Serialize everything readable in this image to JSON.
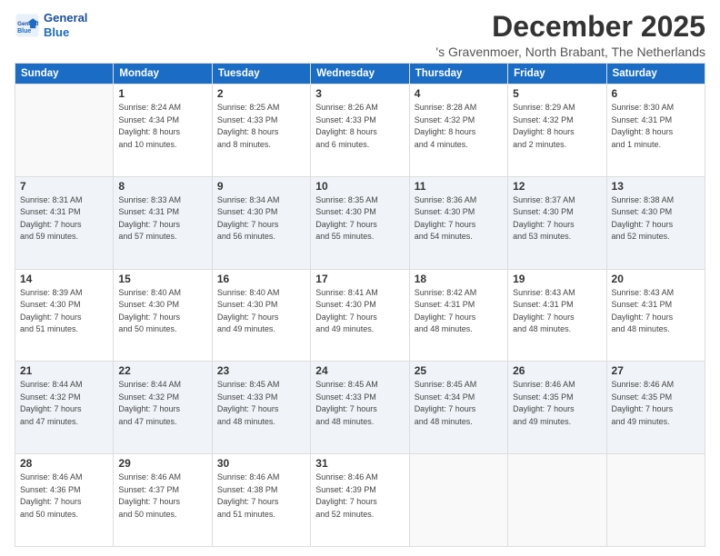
{
  "logo": {
    "line1": "General",
    "line2": "Blue"
  },
  "title": "December 2025",
  "location": "'s Gravenmoer, North Brabant, The Netherlands",
  "days_header": [
    "Sunday",
    "Monday",
    "Tuesday",
    "Wednesday",
    "Thursday",
    "Friday",
    "Saturday"
  ],
  "weeks": [
    [
      {
        "day": "",
        "info": ""
      },
      {
        "day": "1",
        "info": "Sunrise: 8:24 AM\nSunset: 4:34 PM\nDaylight: 8 hours\nand 10 minutes."
      },
      {
        "day": "2",
        "info": "Sunrise: 8:25 AM\nSunset: 4:33 PM\nDaylight: 8 hours\nand 8 minutes."
      },
      {
        "day": "3",
        "info": "Sunrise: 8:26 AM\nSunset: 4:33 PM\nDaylight: 8 hours\nand 6 minutes."
      },
      {
        "day": "4",
        "info": "Sunrise: 8:28 AM\nSunset: 4:32 PM\nDaylight: 8 hours\nand 4 minutes."
      },
      {
        "day": "5",
        "info": "Sunrise: 8:29 AM\nSunset: 4:32 PM\nDaylight: 8 hours\nand 2 minutes."
      },
      {
        "day": "6",
        "info": "Sunrise: 8:30 AM\nSunset: 4:31 PM\nDaylight: 8 hours\nand 1 minute."
      }
    ],
    [
      {
        "day": "7",
        "info": "Sunrise: 8:31 AM\nSunset: 4:31 PM\nDaylight: 7 hours\nand 59 minutes."
      },
      {
        "day": "8",
        "info": "Sunrise: 8:33 AM\nSunset: 4:31 PM\nDaylight: 7 hours\nand 57 minutes."
      },
      {
        "day": "9",
        "info": "Sunrise: 8:34 AM\nSunset: 4:30 PM\nDaylight: 7 hours\nand 56 minutes."
      },
      {
        "day": "10",
        "info": "Sunrise: 8:35 AM\nSunset: 4:30 PM\nDaylight: 7 hours\nand 55 minutes."
      },
      {
        "day": "11",
        "info": "Sunrise: 8:36 AM\nSunset: 4:30 PM\nDaylight: 7 hours\nand 54 minutes."
      },
      {
        "day": "12",
        "info": "Sunrise: 8:37 AM\nSunset: 4:30 PM\nDaylight: 7 hours\nand 53 minutes."
      },
      {
        "day": "13",
        "info": "Sunrise: 8:38 AM\nSunset: 4:30 PM\nDaylight: 7 hours\nand 52 minutes."
      }
    ],
    [
      {
        "day": "14",
        "info": "Sunrise: 8:39 AM\nSunset: 4:30 PM\nDaylight: 7 hours\nand 51 minutes."
      },
      {
        "day": "15",
        "info": "Sunrise: 8:40 AM\nSunset: 4:30 PM\nDaylight: 7 hours\nand 50 minutes."
      },
      {
        "day": "16",
        "info": "Sunrise: 8:40 AM\nSunset: 4:30 PM\nDaylight: 7 hours\nand 49 minutes."
      },
      {
        "day": "17",
        "info": "Sunrise: 8:41 AM\nSunset: 4:30 PM\nDaylight: 7 hours\nand 49 minutes."
      },
      {
        "day": "18",
        "info": "Sunrise: 8:42 AM\nSunset: 4:31 PM\nDaylight: 7 hours\nand 48 minutes."
      },
      {
        "day": "19",
        "info": "Sunrise: 8:43 AM\nSunset: 4:31 PM\nDaylight: 7 hours\nand 48 minutes."
      },
      {
        "day": "20",
        "info": "Sunrise: 8:43 AM\nSunset: 4:31 PM\nDaylight: 7 hours\nand 48 minutes."
      }
    ],
    [
      {
        "day": "21",
        "info": "Sunrise: 8:44 AM\nSunset: 4:32 PM\nDaylight: 7 hours\nand 47 minutes."
      },
      {
        "day": "22",
        "info": "Sunrise: 8:44 AM\nSunset: 4:32 PM\nDaylight: 7 hours\nand 47 minutes."
      },
      {
        "day": "23",
        "info": "Sunrise: 8:45 AM\nSunset: 4:33 PM\nDaylight: 7 hours\nand 48 minutes."
      },
      {
        "day": "24",
        "info": "Sunrise: 8:45 AM\nSunset: 4:33 PM\nDaylight: 7 hours\nand 48 minutes."
      },
      {
        "day": "25",
        "info": "Sunrise: 8:45 AM\nSunset: 4:34 PM\nDaylight: 7 hours\nand 48 minutes."
      },
      {
        "day": "26",
        "info": "Sunrise: 8:46 AM\nSunset: 4:35 PM\nDaylight: 7 hours\nand 49 minutes."
      },
      {
        "day": "27",
        "info": "Sunrise: 8:46 AM\nSunset: 4:35 PM\nDaylight: 7 hours\nand 49 minutes."
      }
    ],
    [
      {
        "day": "28",
        "info": "Sunrise: 8:46 AM\nSunset: 4:36 PM\nDaylight: 7 hours\nand 50 minutes."
      },
      {
        "day": "29",
        "info": "Sunrise: 8:46 AM\nSunset: 4:37 PM\nDaylight: 7 hours\nand 50 minutes."
      },
      {
        "day": "30",
        "info": "Sunrise: 8:46 AM\nSunset: 4:38 PM\nDaylight: 7 hours\nand 51 minutes."
      },
      {
        "day": "31",
        "info": "Sunrise: 8:46 AM\nSunset: 4:39 PM\nDaylight: 7 hours\nand 52 minutes."
      },
      {
        "day": "",
        "info": ""
      },
      {
        "day": "",
        "info": ""
      },
      {
        "day": "",
        "info": ""
      }
    ]
  ]
}
